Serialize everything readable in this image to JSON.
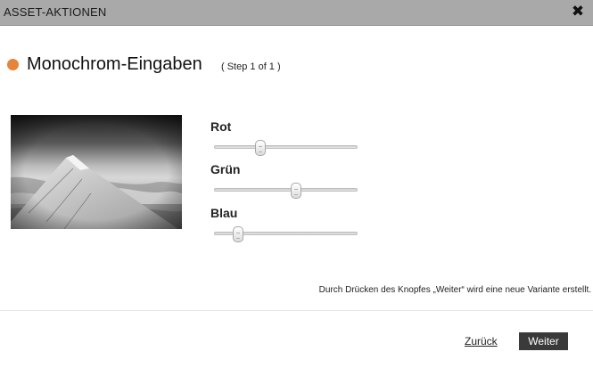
{
  "dialog": {
    "title": "ASSET-AKTIONEN",
    "close_icon": "close-icon",
    "close_glyph": "✖"
  },
  "heading": {
    "title": "Monochrom-Eingaben",
    "step": "( Step 1 of 1 )",
    "dot_color": "#e6843a"
  },
  "preview": {
    "image": "airplane-wing-monochrome"
  },
  "sliders": [
    {
      "label": "Rot",
      "value": 0.31
    },
    {
      "label": "Grün",
      "value": 0.58
    },
    {
      "label": "Blau",
      "value": 0.14
    }
  ],
  "notice": "Durch Drücken des Knopfes „Weiter“ wird eine neue Variante erstellt.",
  "footer": {
    "back_label": "Zurück",
    "next_label": "Weiter"
  }
}
